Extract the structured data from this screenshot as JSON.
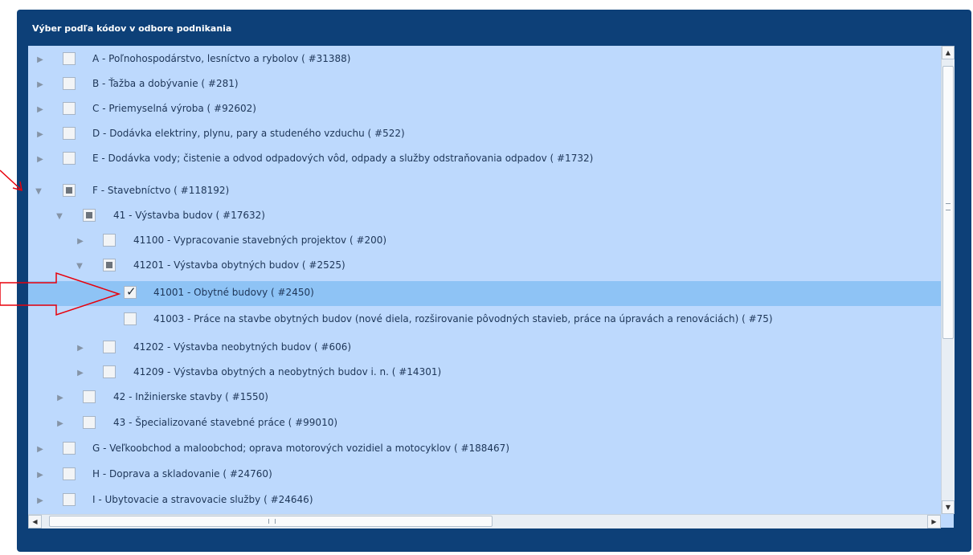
{
  "panel": {
    "title": "Výber podľa kódov v odbore podnikania"
  },
  "tree": {
    "rows": [
      {
        "label": "A - Poľnohospodárstvo, lesníctvo a rybolov ( #31388)",
        "expander": "collapsed",
        "check": "none"
      },
      {
        "label": "B - Ťažba a dobývanie ( #281)",
        "expander": "collapsed",
        "check": "none"
      },
      {
        "label": "C - Priemyselná výroba ( #92602)",
        "expander": "collapsed",
        "check": "none"
      },
      {
        "label": "D - Dodávka elektriny, plynu, pary a studeného vzduchu ( #522)",
        "expander": "collapsed",
        "check": "none"
      },
      {
        "label": "E - Dodávka vody; čistenie a odvod odpadových vôd, odpady a služby odstraňovania odpadov ( #1732)",
        "expander": "collapsed",
        "check": "none"
      },
      {
        "label": "F - Stavebníctvo ( #118192)",
        "expander": "expanded",
        "check": "partial"
      },
      {
        "label": "41 - Výstavba budov ( #17632)",
        "expander": "expanded",
        "check": "partial"
      },
      {
        "label": "41100 - Vypracovanie stavebných projektov ( #200)",
        "expander": "collapsed",
        "check": "none"
      },
      {
        "label": "41201 - Výstavba obytných budov ( #2525)",
        "expander": "expanded",
        "check": "partial"
      },
      {
        "label": "41001 - Obytné budovy ( #2450)",
        "expander": "none",
        "check": "checked"
      },
      {
        "label": "41003 - Práce na stavbe obytných budov (nové diela, rozširovanie pôvodných stavieb, práce na úpravách a renováciách) ( #75)",
        "expander": "none",
        "check": "none"
      },
      {
        "label": "41202 - Výstavba neobytných budov ( #606)",
        "expander": "collapsed",
        "check": "none"
      },
      {
        "label": "41209 - Výstavba obytných a neobytných budov i. n. ( #14301)",
        "expander": "collapsed",
        "check": "none"
      },
      {
        "label": "42 - Inžinierske stavby ( #1550)",
        "expander": "collapsed",
        "check": "none"
      },
      {
        "label": "43 - Špecializované stavebné práce ( #99010)",
        "expander": "collapsed",
        "check": "none"
      },
      {
        "label": "G - Veľkoobchod a maloobchod; oprava motorových vozidiel a motocyklov ( #188467)",
        "expander": "collapsed",
        "check": "none"
      },
      {
        "label": "H - Doprava a skladovanie ( #24760)",
        "expander": "collapsed",
        "check": "none"
      },
      {
        "label": "I - Ubytovacie a stravovacie služby ( #24646)",
        "expander": "collapsed",
        "check": "none"
      }
    ]
  },
  "colors": {
    "panel_bg": "#0d4078",
    "tree_bg": "#bdd9fd",
    "selected_row": "#8ec3f5",
    "annotation_arrow": "#e8000b"
  }
}
